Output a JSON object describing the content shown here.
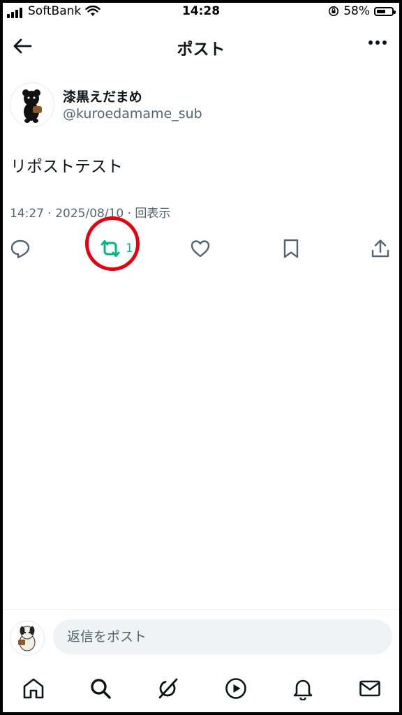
{
  "status_bar": {
    "carrier": "SoftBank",
    "time": "14:28",
    "battery_percent": "58%",
    "battery_level": 0.58
  },
  "header": {
    "title": "ポスト"
  },
  "post": {
    "author_name": "漆黒えだまめ",
    "author_handle": "@kuroedamame_sub",
    "text": "リポストテスト",
    "meta": "14:27 · 2025/08/10 · 回表示",
    "repost_count": "1"
  },
  "reply": {
    "placeholder": "返信をポスト"
  },
  "colors": {
    "repost_active": "#00ba7c",
    "highlight_ring": "#e50012",
    "text_secondary": "#536471"
  },
  "icons": [
    "back-arrow-icon",
    "more-icon",
    "reply-icon",
    "repost-icon",
    "like-icon",
    "bookmark-icon",
    "share-icon",
    "home-icon",
    "search-icon",
    "grok-icon",
    "video-icon",
    "notifications-icon",
    "messages-icon"
  ]
}
